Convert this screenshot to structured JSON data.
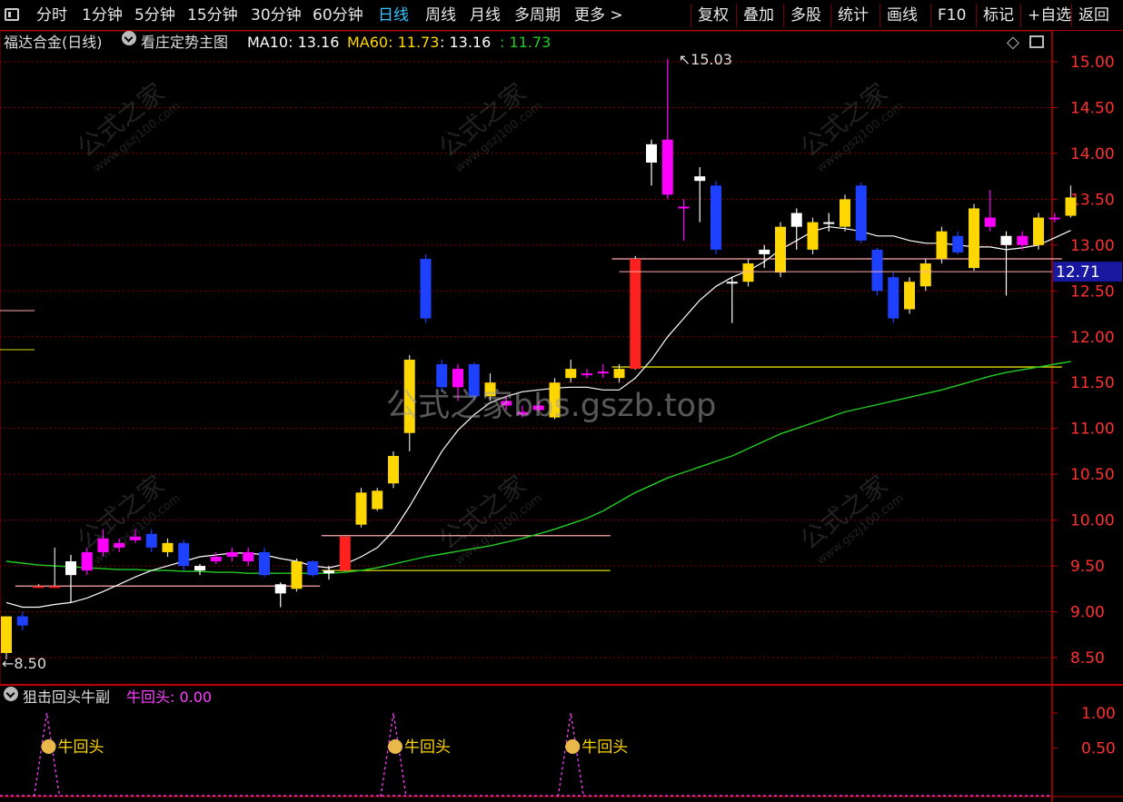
{
  "toolbar": {
    "left_items": [
      "分时",
      "1分钟",
      "5分钟",
      "15分钟",
      "30分钟",
      "60分钟",
      "日线",
      "周线",
      "月线",
      "多周期",
      "更多 >"
    ],
    "active_index": 6,
    "right_items": [
      "复权",
      "叠加",
      "多股",
      "统计",
      "画线",
      "F10",
      "标记",
      "+自选",
      "返回"
    ]
  },
  "info": {
    "stock_name": "福达合金(日线)",
    "indicator_name": "看庄定势主图",
    "ma10_label": "MA10: 13.16",
    "ma60_label": "MA60: 11.73",
    "val1": ": 13.16",
    "val2": ": 11.73",
    "icon": "chevron-down-icon",
    "diamond_icon": "diamond-icon",
    "panel_icon": "panel-toggle-icon"
  },
  "price_axis": {
    "ticks": [
      "15.00",
      "14.50",
      "14.00",
      "13.50",
      "13.00",
      "12.50",
      "12.00",
      "11.50",
      "11.00",
      "10.50",
      "10.00",
      "9.50",
      "9.00",
      "8.50"
    ],
    "current_price": "12.71",
    "high_label": "15.03",
    "low_label": "8.50"
  },
  "sub": {
    "indicator_name": "狙击回头牛副",
    "value_label": "牛回头: 0.00",
    "ticks": [
      "1.00",
      "0.50"
    ],
    "signal_label": "牛回头",
    "signal_icon": "money-bag-icon"
  },
  "watermark": {
    "main": "公式之家bbs.gszb.top",
    "cn": "公式之家",
    "url": "www.gszj100.com"
  },
  "colors": {
    "up_yellow": "#ffd700",
    "up_magenta": "#ff00ff",
    "down_blue": "#1e40ff",
    "down_white": "#ffffff",
    "red": "#ff2020",
    "ma10": "#ffffff",
    "ma60": "#22cc22",
    "grid": "#8b0000",
    "signal": "#ff40ff",
    "cur_price_bg": "#1818a0"
  },
  "chart_data": {
    "type": "candlestick",
    "ylim": [
      8.3,
      15.3
    ],
    "candles": [
      [
        8.55,
        8.95,
        8.95,
        8.48,
        "y"
      ],
      [
        8.95,
        8.85,
        9.0,
        8.8,
        "b"
      ],
      [
        9.28,
        9.28,
        9.3,
        9.26,
        "r"
      ],
      [
        9.28,
        9.28,
        9.7,
        9.26,
        "r"
      ],
      [
        9.4,
        9.55,
        9.62,
        9.1,
        "w"
      ],
      [
        9.45,
        9.65,
        9.7,
        9.4,
        "m"
      ],
      [
        9.65,
        9.8,
        9.9,
        9.6,
        "m"
      ],
      [
        9.7,
        9.75,
        9.8,
        9.65,
        "m"
      ],
      [
        9.82,
        9.78,
        9.9,
        9.75,
        "m"
      ],
      [
        9.85,
        9.7,
        9.9,
        9.65,
        "b"
      ],
      [
        9.75,
        9.65,
        9.8,
        9.6,
        "y"
      ],
      [
        9.75,
        9.5,
        9.78,
        9.45,
        "b"
      ],
      [
        9.45,
        9.5,
        9.52,
        9.4,
        "w"
      ],
      [
        9.55,
        9.6,
        9.65,
        9.52,
        "m"
      ],
      [
        9.6,
        9.65,
        9.7,
        9.55,
        "m"
      ],
      [
        9.65,
        9.55,
        9.7,
        9.5,
        "m"
      ],
      [
        9.65,
        9.4,
        9.7,
        9.38,
        "b"
      ],
      [
        9.3,
        9.2,
        9.32,
        9.05,
        "w"
      ],
      [
        9.25,
        9.55,
        9.58,
        9.22,
        "y"
      ],
      [
        9.55,
        9.4,
        9.56,
        9.38,
        "b"
      ],
      [
        9.42,
        9.45,
        9.5,
        9.35,
        "w"
      ],
      [
        9.45,
        9.82,
        9.82,
        9.44,
        "r"
      ],
      [
        9.95,
        10.3,
        10.35,
        9.92,
        "y"
      ],
      [
        10.12,
        10.32,
        10.35,
        10.1,
        "y"
      ],
      [
        10.4,
        10.7,
        10.75,
        10.35,
        "y"
      ],
      [
        10.95,
        11.75,
        11.8,
        10.75,
        "y"
      ],
      [
        12.85,
        12.2,
        12.9,
        12.15,
        "b"
      ],
      [
        11.7,
        11.45,
        11.75,
        11.4,
        "b"
      ],
      [
        11.65,
        11.45,
        11.7,
        11.3,
        "m"
      ],
      [
        11.7,
        11.35,
        11.72,
        11.3,
        "b"
      ],
      [
        11.35,
        11.5,
        11.6,
        11.3,
        "y"
      ],
      [
        11.3,
        11.25,
        11.35,
        11.2,
        "m"
      ],
      [
        11.18,
        11.15,
        11.25,
        11.12,
        "m"
      ],
      [
        11.25,
        11.2,
        11.3,
        11.18,
        "m"
      ],
      [
        11.12,
        11.5,
        11.55,
        11.1,
        "y"
      ],
      [
        11.55,
        11.65,
        11.75,
        11.5,
        "y"
      ],
      [
        11.58,
        11.6,
        11.65,
        11.55,
        "m"
      ],
      [
        11.62,
        11.6,
        11.7,
        11.55,
        "m"
      ],
      [
        11.55,
        11.65,
        11.7,
        11.5,
        "y"
      ],
      [
        11.65,
        12.85,
        12.88,
        11.64,
        "r"
      ],
      [
        13.9,
        14.1,
        14.15,
        13.65,
        "w"
      ],
      [
        14.15,
        13.55,
        15.03,
        13.5,
        "m"
      ],
      [
        13.4,
        13.42,
        13.5,
        13.05,
        "m"
      ],
      [
        13.75,
        13.7,
        13.85,
        13.25,
        "w"
      ],
      [
        13.65,
        12.95,
        13.7,
        12.9,
        "b"
      ],
      [
        12.6,
        12.6,
        12.65,
        12.15,
        "w"
      ],
      [
        12.6,
        12.8,
        12.85,
        12.55,
        "y"
      ],
      [
        12.9,
        12.95,
        13.0,
        12.75,
        "w"
      ],
      [
        12.7,
        13.2,
        13.25,
        12.65,
        "y"
      ],
      [
        13.2,
        13.35,
        13.4,
        12.95,
        "w"
      ],
      [
        12.95,
        13.25,
        13.3,
        12.9,
        "y"
      ],
      [
        13.25,
        13.25,
        13.35,
        13.15,
        "w"
      ],
      [
        13.2,
        13.5,
        13.55,
        13.15,
        "y"
      ],
      [
        13.65,
        13.05,
        13.68,
        13.02,
        "b"
      ],
      [
        12.95,
        12.5,
        12.97,
        12.45,
        "b"
      ],
      [
        12.65,
        12.2,
        12.7,
        12.15,
        "b"
      ],
      [
        12.3,
        12.6,
        12.65,
        12.25,
        "y"
      ],
      [
        12.55,
        12.8,
        12.85,
        12.5,
        "y"
      ],
      [
        12.85,
        13.15,
        13.2,
        12.8,
        "y"
      ],
      [
        13.1,
        12.92,
        13.15,
        12.9,
        "b"
      ],
      [
        12.75,
        13.4,
        13.45,
        12.72,
        "y"
      ],
      [
        13.3,
        13.2,
        13.6,
        13.15,
        "m"
      ],
      [
        13.1,
        13.0,
        13.15,
        12.45,
        "w"
      ],
      [
        13.0,
        13.1,
        13.15,
        12.95,
        "m"
      ],
      [
        13.0,
        13.3,
        13.35,
        12.95,
        "y"
      ],
      [
        13.3,
        13.3,
        13.35,
        13.25,
        "m"
      ],
      [
        13.32,
        13.52,
        13.65,
        13.3,
        "y"
      ]
    ],
    "ma10": [
      9.1,
      9.05,
      9.05,
      9.08,
      9.1,
      9.15,
      9.22,
      9.3,
      9.38,
      9.45,
      9.5,
      9.55,
      9.6,
      9.62,
      9.64,
      9.64,
      9.62,
      9.58,
      9.55,
      9.5,
      9.48,
      9.52,
      9.6,
      9.7,
      9.88,
      10.15,
      10.45,
      10.75,
      10.98,
      11.15,
      11.28,
      11.35,
      11.4,
      11.42,
      11.44,
      11.45,
      11.45,
      11.42,
      11.42,
      11.55,
      11.75,
      12.0,
      12.2,
      12.4,
      12.55,
      12.65,
      12.72,
      12.82,
      12.95,
      13.05,
      13.15,
      13.2,
      13.18,
      13.15,
      13.1,
      13.1,
      13.05,
      13.02,
      13.02,
      13.0,
      12.98,
      12.98,
      12.95,
      12.97,
      13.0,
      13.08,
      13.16
    ],
    "ma60": [
      9.55,
      9.53,
      9.51,
      9.5,
      9.49,
      9.48,
      9.47,
      9.46,
      9.46,
      9.45,
      9.45,
      9.44,
      9.44,
      9.43,
      9.43,
      9.42,
      9.42,
      9.42,
      9.42,
      9.42,
      9.42,
      9.43,
      9.45,
      9.48,
      9.52,
      9.56,
      9.6,
      9.63,
      9.66,
      9.69,
      9.72,
      9.76,
      9.8,
      9.85,
      9.9,
      9.96,
      10.02,
      10.1,
      10.2,
      10.3,
      10.38,
      10.46,
      10.52,
      10.58,
      10.64,
      10.7,
      10.78,
      10.86,
      10.94,
      11.0,
      11.06,
      11.12,
      11.18,
      11.22,
      11.26,
      11.3,
      11.34,
      11.38,
      11.42,
      11.47,
      11.52,
      11.57,
      11.61,
      11.64,
      11.67,
      11.7,
      11.73
    ],
    "support_lines": [
      {
        "from": 1,
        "to": 19,
        "y": 9.28,
        "color": "#ffaaaa"
      },
      {
        "from": 20,
        "to": 37,
        "y": 9.83,
        "color": "#ffaaaa"
      },
      {
        "from": 20,
        "to": 37,
        "y": 9.45,
        "color": "#dddd00"
      },
      {
        "from": 38,
        "to": 65,
        "y": 12.85,
        "color": "#ffaaaa"
      },
      {
        "from": 38,
        "to": 65,
        "y": 11.67,
        "color": "#dddd00"
      }
    ],
    "signals": [
      2,
      24,
      35
    ]
  }
}
